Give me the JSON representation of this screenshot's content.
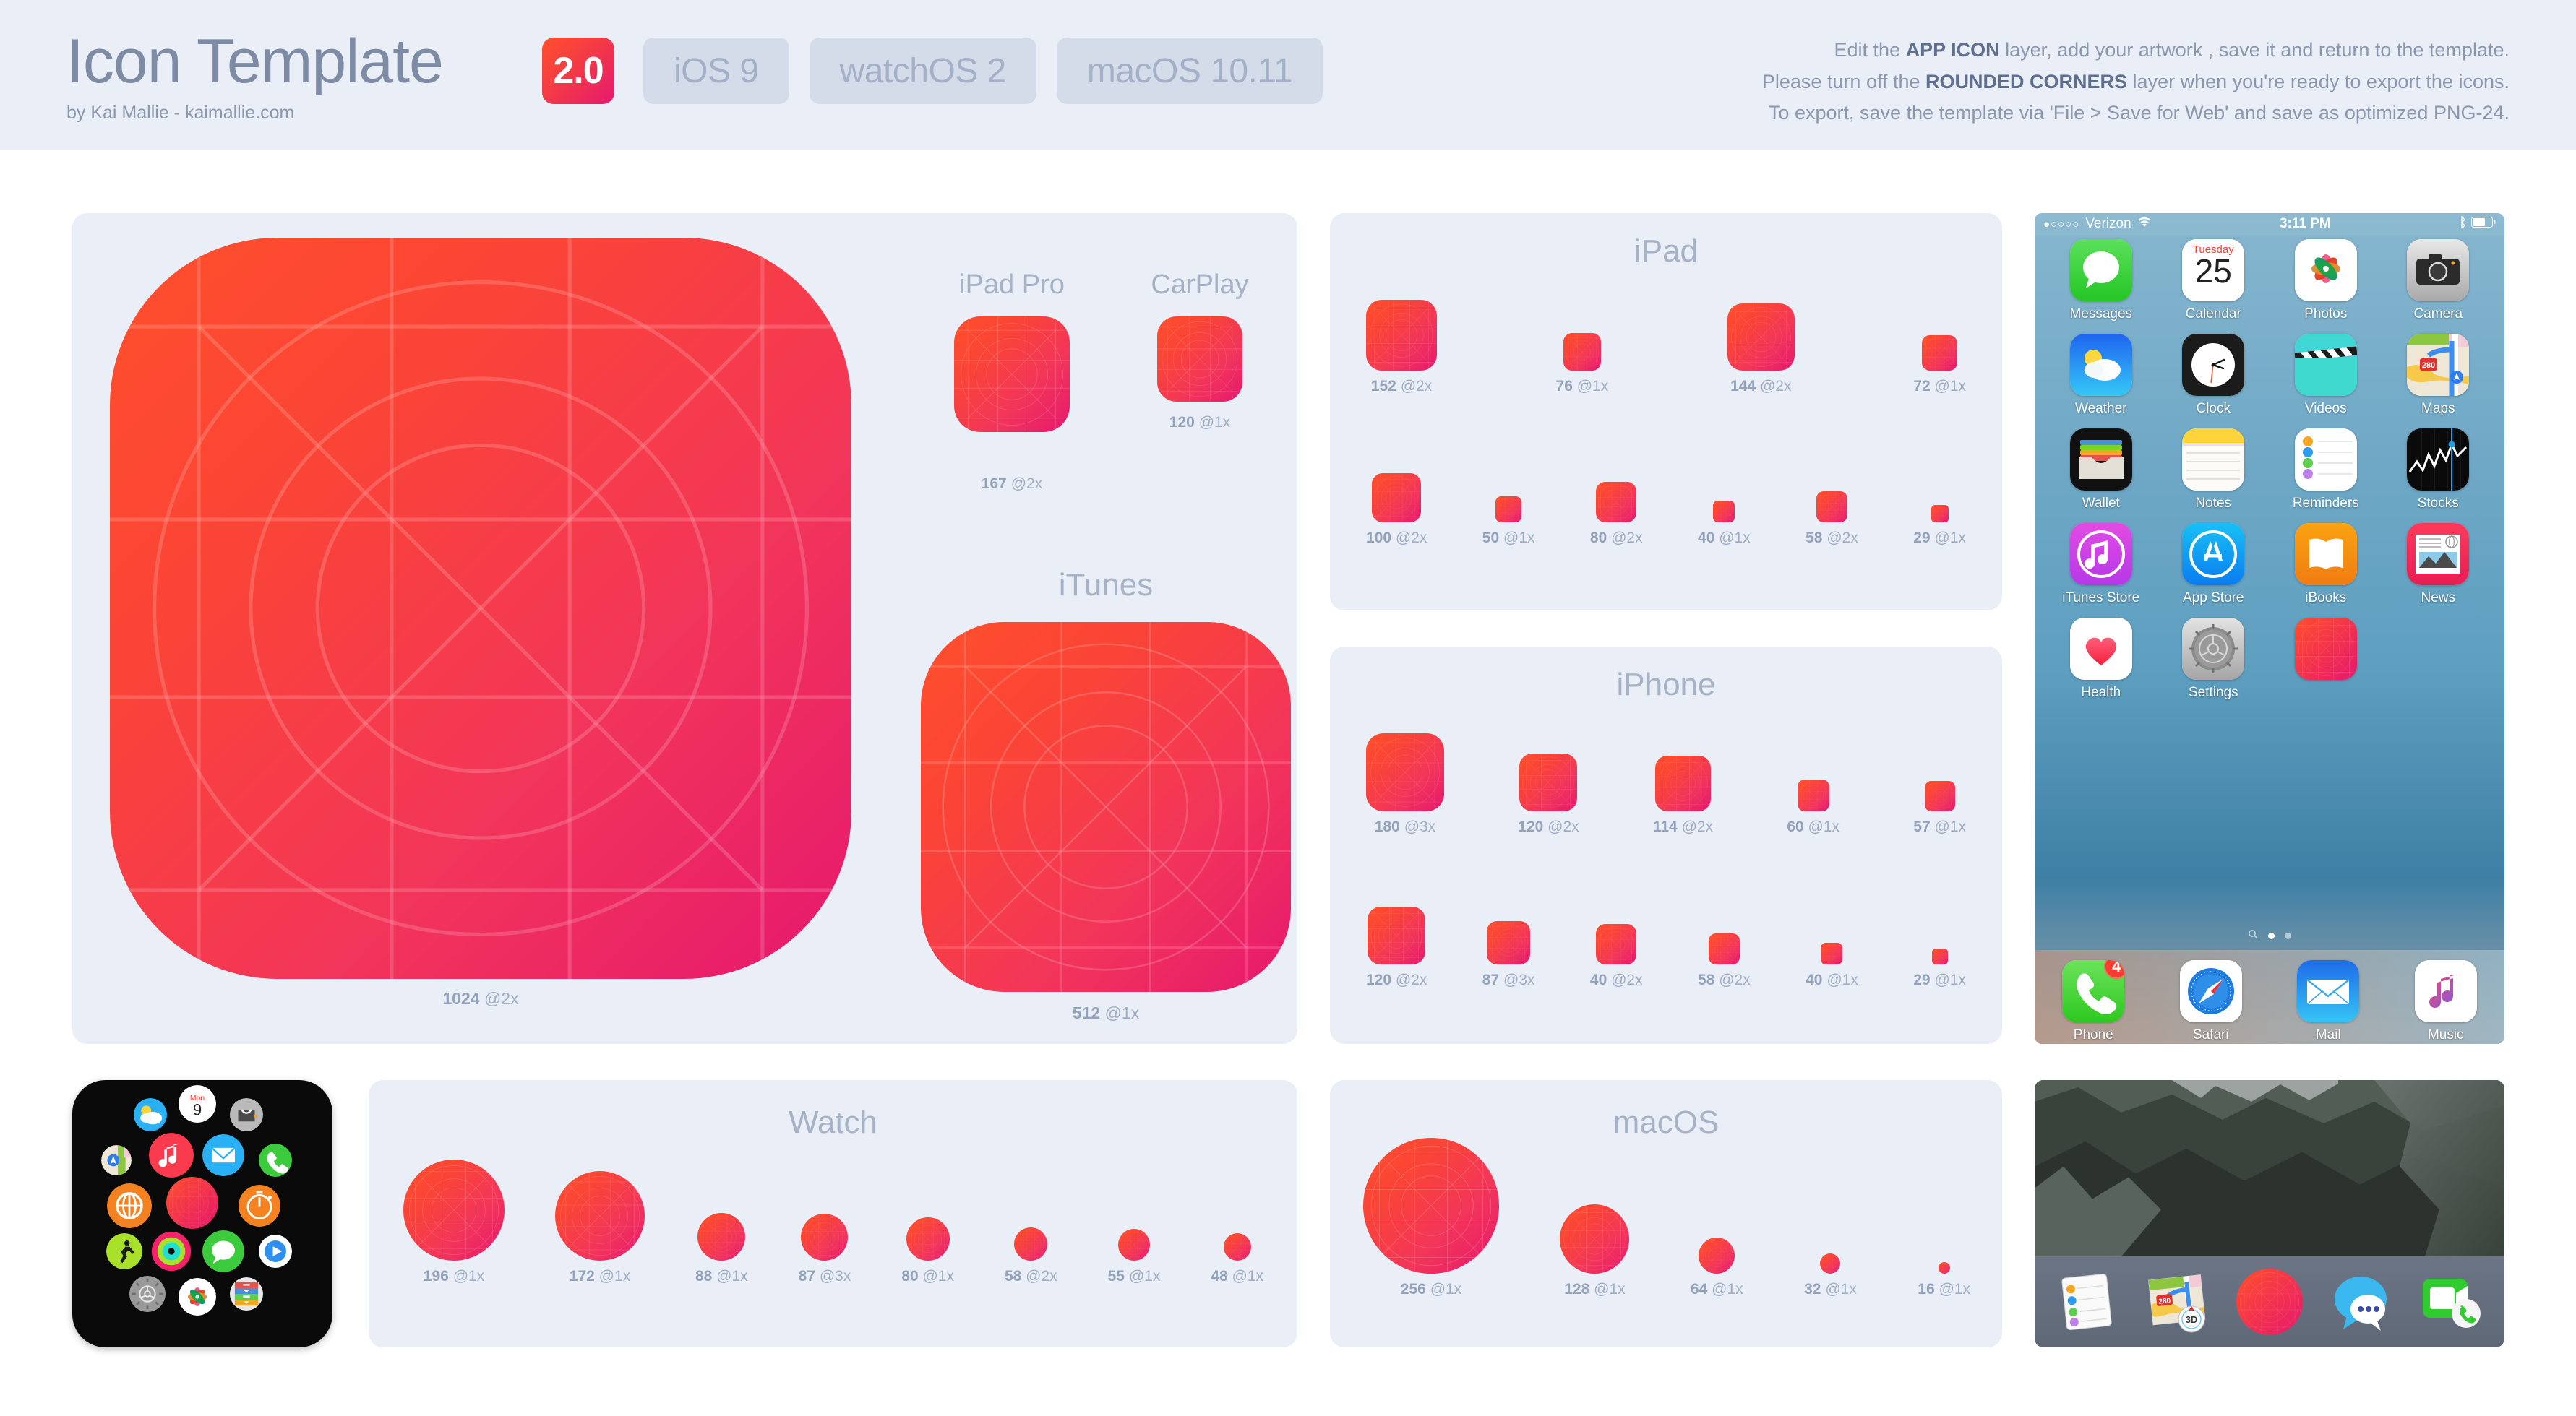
{
  "header": {
    "title": "Icon Template",
    "subtitle": "by Kai Mallie - kaimallie.com",
    "version_badge": "2.0",
    "os_tabs": [
      {
        "label": "iOS 9"
      },
      {
        "label": "watchOS 2"
      },
      {
        "label": "macOS 10.11"
      }
    ],
    "instructions": [
      {
        "pre": "Edit the ",
        "bold": "APP ICON",
        "post": " layer, add your artwork , save it and return to the template."
      },
      {
        "pre": "Please turn off the ",
        "bold": "ROUNDED CORNERS",
        "post": " layer when you're ready to export the icons."
      },
      {
        "pre": "To export, save the template via 'File > Save for Web' and save as optimized PNG-24.",
        "bold": "",
        "post": ""
      }
    ]
  },
  "colors": {
    "page_background": "#FFFFFF",
    "panel_background": "#EAEEF7",
    "header_background": "#EAEEF7",
    "tab_background": "#D4DCEA",
    "label_text": "#9FADC4",
    "title_text": "#A6B2C6",
    "brand_text": "#7D8BA5",
    "icon_gradient_start": "#FF4F2B",
    "icon_gradient_end": "#E6186E",
    "badge_red": "#FF3B30"
  },
  "panels": {
    "master": {
      "main_size_label": {
        "size": "1024",
        "scale": "@2x"
      },
      "ipad_pro": {
        "title": "iPad Pro",
        "size": "167",
        "scale": "@2x"
      },
      "carplay": {
        "title": "CarPlay",
        "size": "120",
        "scale": "@1x"
      },
      "itunes": {
        "title": "iTunes",
        "size": "512",
        "scale": "@1x"
      }
    },
    "ipad": {
      "title": "iPad",
      "row1": [
        {
          "size": "152",
          "scale": "@2x",
          "px": 98
        },
        {
          "size": "76",
          "scale": "@1x",
          "px": 52
        },
        {
          "size": "144",
          "scale": "@2x",
          "px": 93
        },
        {
          "size": "72",
          "scale": "@1x",
          "px": 49
        }
      ],
      "row2": [
        {
          "size": "100",
          "scale": "@2x",
          "px": 68
        },
        {
          "size": "50",
          "scale": "@1x",
          "px": 36
        },
        {
          "size": "80",
          "scale": "@2x",
          "px": 56
        },
        {
          "size": "40",
          "scale": "@1x",
          "px": 30
        },
        {
          "size": "58",
          "scale": "@2x",
          "px": 43
        },
        {
          "size": "29",
          "scale": "@1x",
          "px": 24
        }
      ]
    },
    "iphone": {
      "title": "iPhone",
      "row1": [
        {
          "size": "180",
          "scale": "@3x",
          "px": 108
        },
        {
          "size": "120",
          "scale": "@2x",
          "px": 80
        },
        {
          "size": "114",
          "scale": "@2x",
          "px": 77
        },
        {
          "size": "60",
          "scale": "@1x",
          "px": 44
        },
        {
          "size": "57",
          "scale": "@1x",
          "px": 42
        }
      ],
      "row2": [
        {
          "size": "120",
          "scale": "@2x",
          "px": 80
        },
        {
          "size": "87",
          "scale": "@3x",
          "px": 60
        },
        {
          "size": "40",
          "scale": "@2x",
          "px": 56
        },
        {
          "size": "58",
          "scale": "@2x",
          "px": 43
        },
        {
          "size": "40",
          "scale": "@1x",
          "px": 30
        },
        {
          "size": "29",
          "scale": "@1x",
          "px": 22
        }
      ]
    },
    "watch": {
      "title": "Watch",
      "items": [
        {
          "size": "196",
          "scale": "@1x",
          "px": 140
        },
        {
          "size": "172",
          "scale": "@1x",
          "px": 124
        },
        {
          "size": "88",
          "scale": "@1x",
          "px": 66
        },
        {
          "size": "87",
          "scale": "@3x",
          "px": 65
        },
        {
          "size": "80",
          "scale": "@1x",
          "px": 60
        },
        {
          "size": "58",
          "scale": "@2x",
          "px": 46
        },
        {
          "size": "55",
          "scale": "@1x",
          "px": 44
        },
        {
          "size": "48",
          "scale": "@1x",
          "px": 38
        }
      ]
    },
    "macos": {
      "title": "macOS",
      "items": [
        {
          "size": "256",
          "scale": "@1x",
          "px": 188
        },
        {
          "size": "128",
          "scale": "@1x",
          "px": 96
        },
        {
          "size": "64",
          "scale": "@1x",
          "px": 50
        },
        {
          "size": "32",
          "scale": "@1x",
          "px": 28
        },
        {
          "size": "16",
          "scale": "@1x",
          "px": 16
        }
      ]
    }
  },
  "iphone_mockup": {
    "status": {
      "carrier": "Verizon",
      "time": "3:11 PM",
      "signal_dots": "●○○○○"
    },
    "apps": [
      {
        "name": "Messages",
        "icon": "messages-icon"
      },
      {
        "name": "Calendar",
        "icon": "calendar-icon",
        "weekday": "Tuesday",
        "day": "25"
      },
      {
        "name": "Photos",
        "icon": "photos-icon"
      },
      {
        "name": "Camera",
        "icon": "camera-icon"
      },
      {
        "name": "Weather",
        "icon": "weather-icon"
      },
      {
        "name": "Clock",
        "icon": "clock-icon"
      },
      {
        "name": "Videos",
        "icon": "videos-icon"
      },
      {
        "name": "Maps",
        "icon": "maps-icon",
        "road": "280"
      },
      {
        "name": "Wallet",
        "icon": "wallet-icon"
      },
      {
        "name": "Notes",
        "icon": "notes-icon"
      },
      {
        "name": "Reminders",
        "icon": "reminders-icon"
      },
      {
        "name": "Stocks",
        "icon": "stocks-icon"
      },
      {
        "name": "iTunes Store",
        "icon": "itunes-store-icon"
      },
      {
        "name": "App Store",
        "icon": "app-store-icon"
      },
      {
        "name": "iBooks",
        "icon": "ibooks-icon"
      },
      {
        "name": "News",
        "icon": "news-icon"
      },
      {
        "name": "Health",
        "icon": "health-icon"
      },
      {
        "name": "Settings",
        "icon": "settings-icon"
      },
      {
        "name": "",
        "icon": "app-icon-placeholder"
      }
    ],
    "dock": [
      {
        "name": "Phone",
        "icon": "phone-icon",
        "badge": "4"
      },
      {
        "name": "Safari",
        "icon": "safari-icon"
      },
      {
        "name": "Mail",
        "icon": "mail-icon"
      },
      {
        "name": "Music",
        "icon": "music-icon"
      }
    ]
  },
  "watch_mockup": {
    "calendar": {
      "weekday": "Mon",
      "day": "9"
    },
    "apps": [
      "weather-icon",
      "calendar-icon",
      "passbook-icon",
      "maps-icon",
      "music-icon",
      "mail-icon",
      "phone-icon",
      "safari-icon",
      "app-icon-placeholder",
      "timer-icon",
      "workout-icon",
      "activity-icon",
      "messages-icon",
      "remote-icon",
      "settings-icon",
      "photos-icon",
      "passbook-colored-icon"
    ]
  },
  "macos_mockup": {
    "dock": [
      "reminders-icon",
      "maps-icon",
      "app-icon-placeholder",
      "messages-icon",
      "facetime-icon"
    ]
  }
}
